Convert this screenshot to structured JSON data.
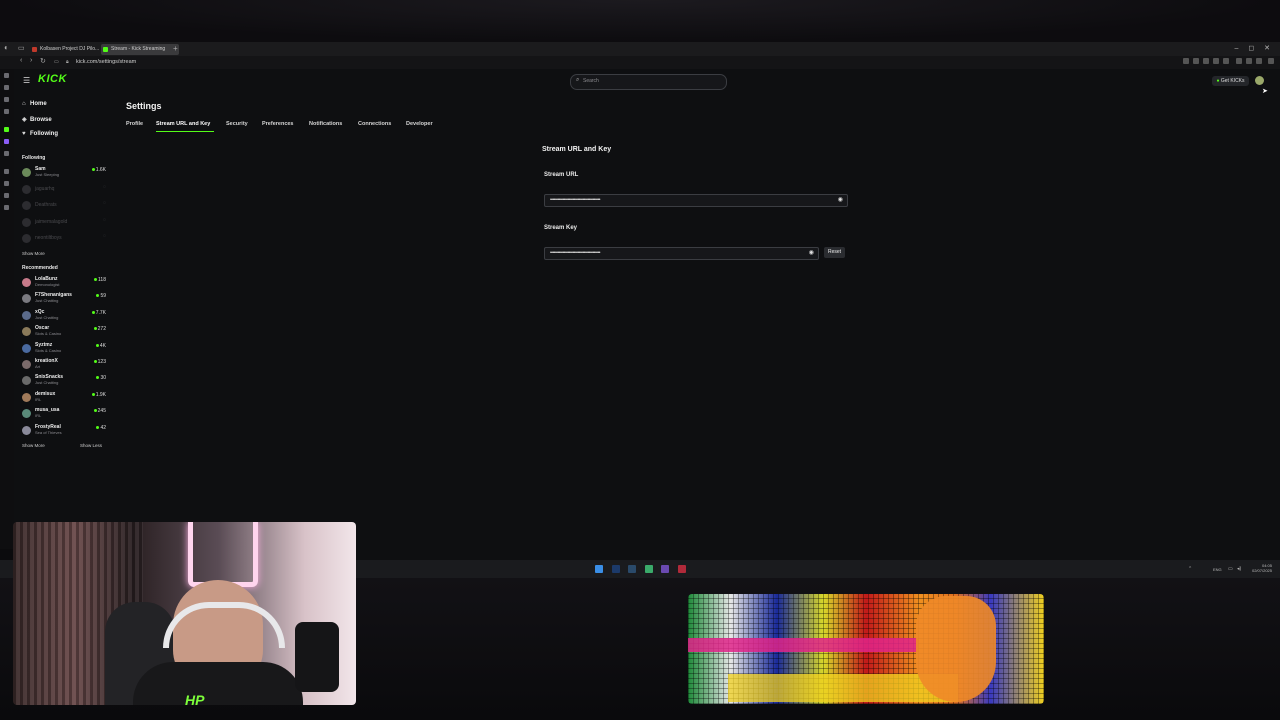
{
  "browser": {
    "tabs": [
      {
        "label": "Kolbasen Project DJ Pilo...",
        "favicon_color": "#c0392b"
      },
      {
        "label": "Stream - Kick Streaming",
        "favicon_color": "#53fc18"
      }
    ],
    "new_tab": "+",
    "window_controls": "– ◻ ✕",
    "url": "kick.com/settings/stream"
  },
  "header": {
    "logo": "KICK",
    "search_placeholder": "Search",
    "get_kicks": "Get KICKs"
  },
  "sidebar": {
    "nav": [
      {
        "label": "Home",
        "icon": "home-icon"
      },
      {
        "label": "Browse",
        "icon": "compass-icon"
      },
      {
        "label": "Following",
        "icon": "heart-icon"
      }
    ],
    "following_title": "Following",
    "following": [
      {
        "name": "Sam",
        "sub": "Just Sleeping",
        "viewers": "1.6K",
        "live": true
      },
      {
        "name": "jaguarhq",
        "sub": "",
        "viewers": "",
        "live": false
      },
      {
        "name": "Deathrats",
        "sub": "",
        "viewers": "",
        "live": false
      },
      {
        "name": "jaimemalagold",
        "sub": "",
        "viewers": "",
        "live": false
      },
      {
        "name": "neontiltboys",
        "sub": "",
        "viewers": "",
        "live": false
      }
    ],
    "following_show_more": "Show More",
    "recommended_title": "Recommended",
    "recommended": [
      {
        "name": "LolaBunz",
        "sub": "Demonologist",
        "viewers": "118"
      },
      {
        "name": "F7Shenanigans",
        "sub": "Just Chatting",
        "viewers": "59"
      },
      {
        "name": "xQc",
        "sub": "Just Chatting",
        "viewers": "7.7K"
      },
      {
        "name": "Oscar",
        "sub": "Slots & Casino",
        "viewers": "272"
      },
      {
        "name": "Syztmz",
        "sub": "Slots & Casino",
        "viewers": "4K"
      },
      {
        "name": "kreationX",
        "sub": "Art",
        "viewers": "123"
      },
      {
        "name": "SnixSnacks",
        "sub": "Just Chatting",
        "viewers": "30"
      },
      {
        "name": "demisux",
        "sub": "IRL",
        "viewers": "1.9K"
      },
      {
        "name": "musa_usa",
        "sub": "IRL",
        "viewers": "245"
      },
      {
        "name": "FrostyReal",
        "sub": "Sea of Thieves",
        "viewers": "42"
      }
    ],
    "recommended_show_more": "Show More",
    "recommended_show_less": "Show Less"
  },
  "settings": {
    "title": "Settings",
    "tabs": [
      "Profile",
      "Stream URL and Key",
      "Security",
      "Preferences",
      "Notifications",
      "Connections",
      "Developer"
    ],
    "active_tab": "Stream URL and Key",
    "section_title": "Stream URL and Key",
    "stream_url_label": "Stream URL",
    "stream_url_value": "••••••••••••••••••••••••••••••••••••••••",
    "stream_key_label": "Stream Key",
    "stream_key_value": "••••••••••••••••••••••••••••••••••••••••",
    "reset_label": "Reset"
  },
  "taskbar": {
    "lang": "ENG",
    "time": "04:05",
    "date": "02/07/2025"
  },
  "overlay": {
    "webcam_watermark": "HP"
  },
  "colors": {
    "accent": "#53fc18",
    "background": "#0e0f11",
    "field_border": "#3b3d42"
  }
}
